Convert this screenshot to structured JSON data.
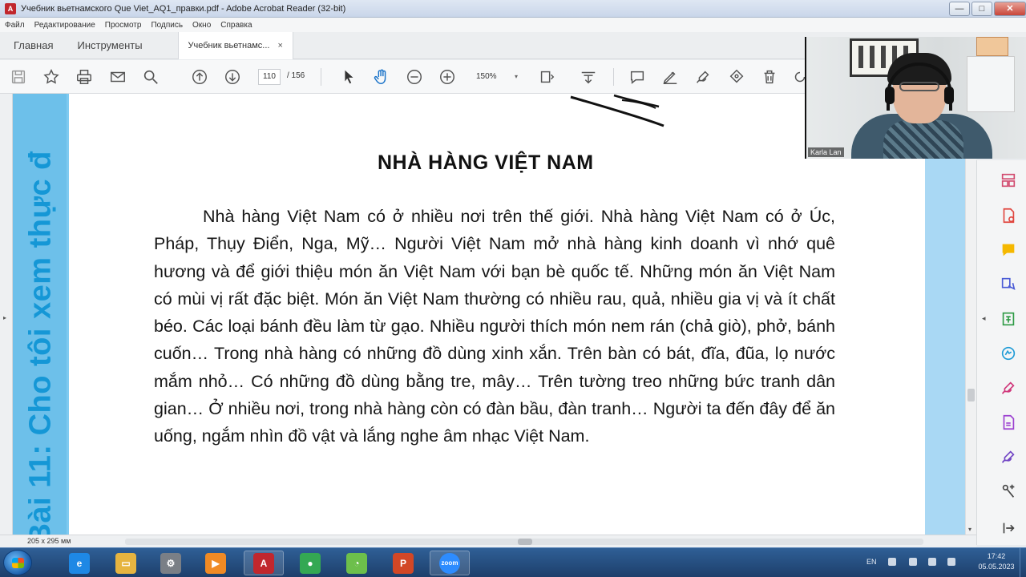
{
  "window": {
    "title": "Учебник вьетнамского Que Viet_AQ1_правки.pdf - Adobe Acrobat Reader (32-bit)",
    "app_icon_letter": "A",
    "minimize": "—",
    "maximize": "□",
    "close": "✕"
  },
  "menu": [
    "Файл",
    "Редактирование",
    "Просмотр",
    "Подпись",
    "Окно",
    "Справка"
  ],
  "tabs": {
    "home": "Главная",
    "tools": "Инструменты",
    "doc": "Учебник вьетнамс...",
    "doc_close": "×"
  },
  "toolbar": {
    "page_current": "110",
    "page_total": "/ 156",
    "zoom": "150%",
    "zoom_caret": "▾"
  },
  "document": {
    "band_text": "Bài 11:  Cho tôi xem thực đ",
    "title": "NHÀ HÀNG VIỆT NAM",
    "body": "Nhà hàng Việt Nam có ở nhiều nơi trên thế giới. Nhà hàng Việt Nam có ở Úc,  Pháp, Thụy Điển, Nga, Mỹ… Người Việt Nam mở nhà hàng kinh doanh vì nhớ quê hương và để giới thiệu món ăn Việt Nam với bạn bè quốc tế. Những món ăn Việt Nam có mùi vị rất đặc biệt. Món ăn Việt Nam thường có nhiều rau, quả, nhiều gia vị và ít chất béo. Các loại bánh đều làm từ gạo. Nhiều người thích món nem rán (chả giò), phở, bánh cuốn… Trong nhà hàng có những đồ dùng xinh xắn. Trên bàn có bát, đĩa, đũa, lọ nước mắm nhỏ… Có những đồ dùng bằng tre, mây… Trên tường treo những bức tranh dân gian… Ở nhiều nơi, trong nhà hàng còn có đàn bầu, đàn tranh… Người ta đến đây để ăn uống, ngắm nhìn đồ vật và lắng nghe âm nhạc Việt Nam."
  },
  "status": {
    "page_size": "205 x 295 мм",
    "caret": "▸"
  },
  "webcam": {
    "name": "Karla Lan"
  },
  "taskbar": {
    "items": [
      {
        "icon": "internet-explorer-icon",
        "color": "#1e88e5",
        "glyph": "e"
      },
      {
        "icon": "file-explorer-icon",
        "color": "#e6b440",
        "glyph": "▭"
      },
      {
        "icon": "settings-tool-icon",
        "color": "#7a7f86",
        "glyph": "⚙"
      },
      {
        "icon": "media-player-icon",
        "color": "#f08a24",
        "glyph": "▶"
      },
      {
        "icon": "adobe-reader-icon",
        "color": "#c1272d",
        "glyph": "A"
      },
      {
        "icon": "chrome-icon",
        "color": "#34a853",
        "glyph": "●"
      },
      {
        "icon": "clock-app-icon",
        "color": "#6dbf4b",
        "glyph": "◔"
      },
      {
        "icon": "powerpoint-icon",
        "color": "#d24726",
        "glyph": "P"
      },
      {
        "icon": "zoom-icon",
        "color": "#2d8cff",
        "glyph": "zoom"
      }
    ],
    "language": "EN",
    "time": "17:42",
    "date": "05.05.2023"
  }
}
